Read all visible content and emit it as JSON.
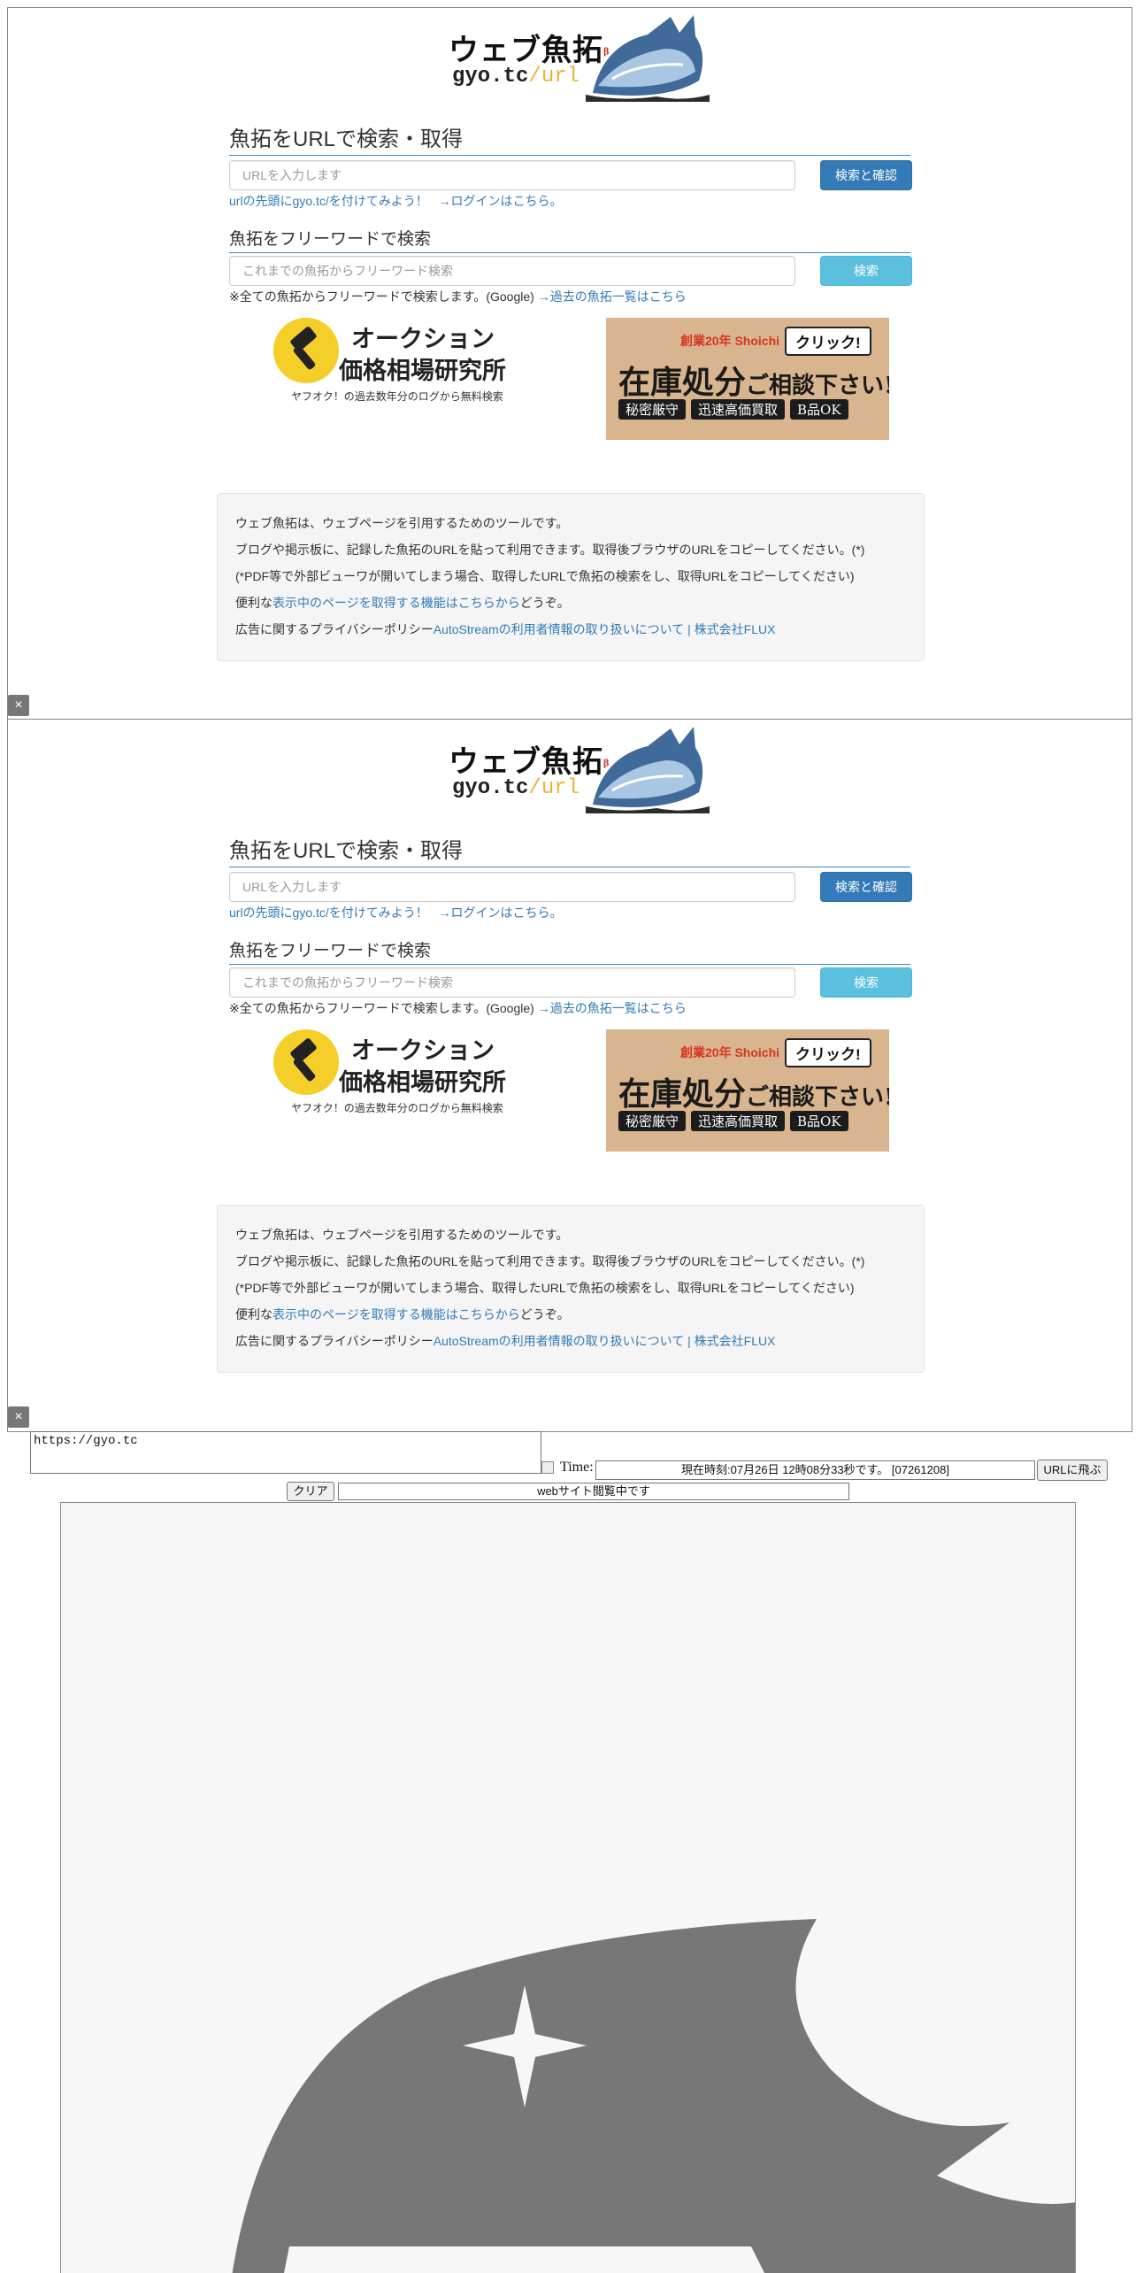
{
  "logo": {
    "title": "ウェブ魚拓",
    "title_mark": "β",
    "url_main": "gyo.tc",
    "url_accent": "/url"
  },
  "url_search": {
    "title": "魚拓をURLで検索・取得",
    "placeholder": "URLを入力します",
    "button": "検索と確認",
    "hint_link1": "urlの先頭にgyo.tc/を付けてみよう！",
    "hint_link2": "→ログインはこちら。"
  },
  "free_search": {
    "title": "魚拓をフリーワードで検索",
    "placeholder": "これまでの魚拓からフリーワード検索",
    "button": "検索",
    "hint_text": "※全ての魚拓からフリーワードで検索します。(Google)",
    "hint_link": "→過去の魚拓一覧はこちら"
  },
  "ad_left": {
    "line1": "オークション",
    "line2": "価格相場研究所",
    "sub": "ヤフオク！の過去数年分のログから無料検索"
  },
  "ad_right": {
    "top": "創業20年 Shoichi",
    "click": "クリック!",
    "main_big": "在庫処分",
    "main_small": "ご相談下さい!",
    "tags": [
      "秘密厳守",
      "迅速高価買取",
      "B品OK"
    ]
  },
  "info": {
    "line1": "ウェブ魚拓は、ウェブページを引用するためのツールです。",
    "line2": "ブログや掲示板に、記録した魚拓のURLを貼って利用できます。取得後ブラウザのURLをコピーしてください。(*)",
    "line3": "(*PDF等で外部ビューワが開いてしまう場合、取得したURLで魚拓の検索をし、取得URLをコピーしてください)",
    "line4_pre": "便利な",
    "line4_link": "表示中のページを取得する機能はこちらから",
    "line4_post": "どうぞ。",
    "line5_pre": "広告に関するプライバシーポリシー",
    "line5_link": "AutoStreamの利用者情報の取り扱いについて | 株式会社FLUX"
  },
  "close_label": "×",
  "controls": {
    "url_value": "https://gyo.tc",
    "time_label": "Time:",
    "time_value": "現在時刻:07月26日 12時08分33秒です。 [07261208]",
    "jump_button": "URLに飛ぶ",
    "clear_button": "クリア",
    "status_value": "webサイト閲覧中です"
  },
  "colors": {
    "primary": "#337ab7",
    "info": "#5bc0de",
    "logo_accent": "#e8b339",
    "viewer_icon": "#777777"
  }
}
